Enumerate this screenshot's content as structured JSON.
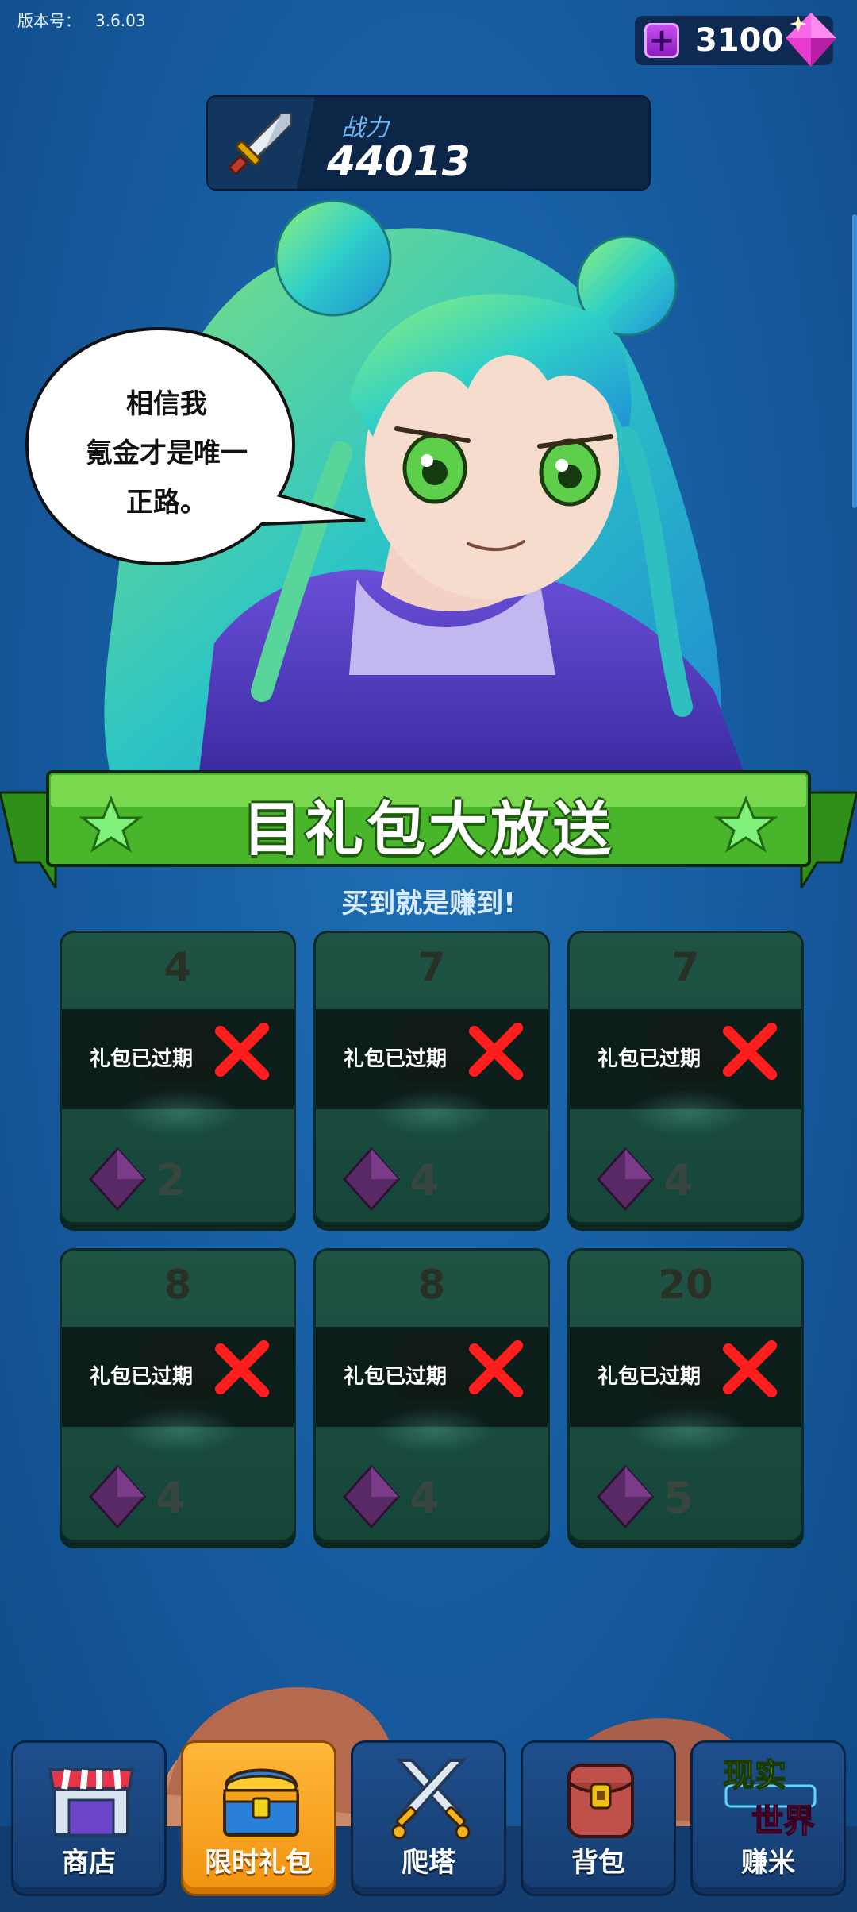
{
  "header": {
    "version_label": "版本号：",
    "version_value": "3.6.03",
    "gem_count": "3100",
    "power_label": "战力",
    "power_value": "44013"
  },
  "character": {
    "speech_line1": "相信我",
    "speech_line2": "氪金才是唯一",
    "speech_line3": "正路。"
  },
  "banner": {
    "title": "目礼包大放送",
    "subtitle": "买到就是赚到!"
  },
  "gift_packs": [
    {
      "number": "4",
      "status": "礼包已过期",
      "price": "2"
    },
    {
      "number": "7",
      "status": "礼包已过期",
      "price": "4"
    },
    {
      "number": "7",
      "status": "礼包已过期",
      "price": "4"
    },
    {
      "number": "8",
      "status": "礼包已过期",
      "price": "4"
    },
    {
      "number": "8",
      "status": "礼包已过期",
      "price": "4"
    },
    {
      "number": "20",
      "status": "礼包已过期",
      "price": "5"
    }
  ],
  "nav": {
    "items": [
      {
        "label": "商店",
        "icon": "shop-icon"
      },
      {
        "label": "限时礼包",
        "icon": "treasure-chest-icon",
        "active": true
      },
      {
        "label": "爬塔",
        "icon": "crossed-swords-icon"
      },
      {
        "label": "背包",
        "icon": "backpack-icon"
      },
      {
        "label": "赚米",
        "icon": "real-world-icon",
        "icon_text_1": "现实",
        "icon_text_2": "世界"
      }
    ]
  },
  "colors": {
    "background": "#165a9e",
    "banner_green": "#4fbf2a",
    "active_tab": "#f5a21c",
    "gem_pink": "#ff4fd8"
  }
}
